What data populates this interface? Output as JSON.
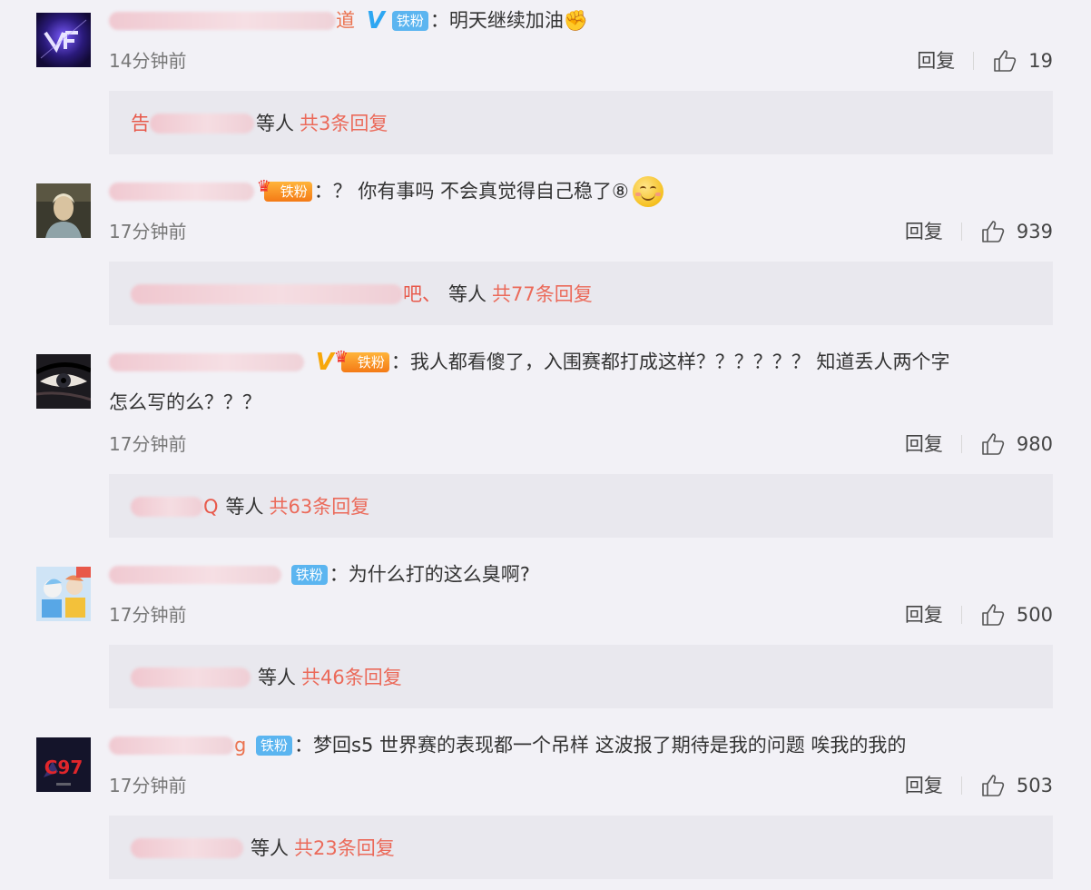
{
  "labels": {
    "reply": "回复",
    "and_others": "等人"
  },
  "comments": [
    {
      "name_tail": "道",
      "verified": "V",
      "fan_badge": "铁粉",
      "colon": "：",
      "text": "明天继续加油",
      "text_emoji": "muscle-emoji",
      "time": "14分钟前",
      "likes": "19",
      "reply_names": "告",
      "reply_total": "共3条回复"
    },
    {
      "name_tail": "",
      "fan_badge": "铁粉",
      "colon": "：",
      "text": "？ 你有事吗 不会真觉得自己稳了⑧",
      "text_emoji": "smile-emoji",
      "time": "17分钟前",
      "likes": "939",
      "reply_names": "吧、",
      "reply_total": "共77条回复"
    },
    {
      "name_tail": "",
      "verified": "V",
      "fan_badge": "铁粉",
      "colon": "：",
      "text": "我人都看傻了，入围赛都打成这样？？？？？？ 知道丢人两个字",
      "text_line2": "怎么写的么？？？",
      "time": "17分钟前",
      "likes": "980",
      "reply_names": "Q",
      "reply_total": "共63条回复"
    },
    {
      "name_tail": "",
      "fan_badge": "铁粉",
      "colon": "：",
      "text": "为什么打的这么臭啊?",
      "time": "17分钟前",
      "likes": "500",
      "reply_names": "",
      "reply_total": "共46条回复"
    },
    {
      "name_tail": "g",
      "fan_badge": "铁粉",
      "colon": "：",
      "text": "梦回s5  世界赛的表现都一个吊样  这波报了期待是我的问题  唉我的我的",
      "time": "17分钟前",
      "likes": "503",
      "reply_names": "",
      "reply_total": "共23条回复"
    }
  ],
  "colors": {
    "background": "#f2f1f6",
    "reply_box": "#e9e8ee",
    "link_red": "#eb6a5a",
    "fan_badge_blue": "#5bb5f0",
    "verified_blue": "#2ea7f2",
    "verified_gold": "#f7a70a"
  }
}
